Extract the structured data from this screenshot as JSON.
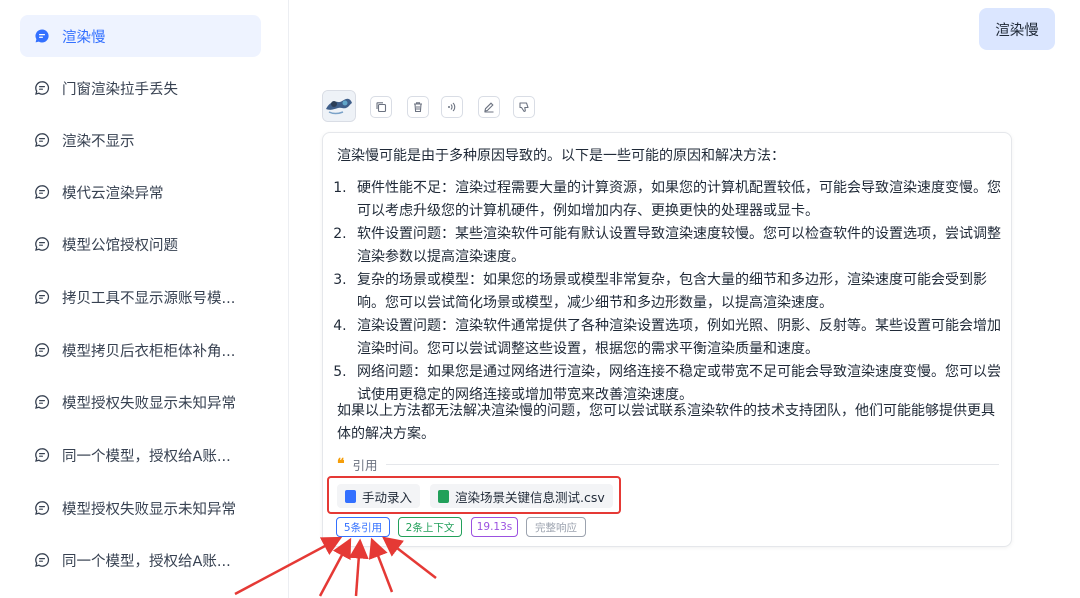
{
  "sidebar": {
    "items": [
      {
        "label": "渲染慢",
        "active": true
      },
      {
        "label": "门窗渲染拉手丢失"
      },
      {
        "label": "渲染不显示"
      },
      {
        "label": "模代云渲染异常"
      },
      {
        "label": "模型公馆授权问题"
      },
      {
        "label": "拷贝工具不显示源账号模..."
      },
      {
        "label": "模型拷贝后衣柜柜体补角..."
      },
      {
        "label": "模型授权失败显示未知异常"
      },
      {
        "label": "同一个模型，授权给A账..."
      },
      {
        "label": "模型授权失败显示未知异常"
      },
      {
        "label": "同一个模型，授权给A账..."
      }
    ]
  },
  "chat": {
    "user_message": "渲染慢",
    "toolbar_icons": [
      "copy-icon",
      "delete-icon",
      "speaker-icon",
      "edit-icon",
      "dislike-icon"
    ],
    "answer": {
      "intro": "渲染慢可能是由于多种原因导致的。以下是一些可能的原因和解决方法：",
      "points": [
        "硬件性能不足：渲染过程需要大量的计算资源，如果您的计算机配置较低，可能会导致渲染速度变慢。您可以考虑升级您的计算机硬件，例如增加内存、更换更快的处理器或显卡。",
        "软件设置问题：某些渲染软件可能有默认设置导致渲染速度较慢。您可以检查软件的设置选项，尝试调整渲染参数以提高渲染速度。",
        "复杂的场景或模型：如果您的场景或模型非常复杂，包含大量的细节和多边形，渲染速度可能会受到影响。您可以尝试简化场景或模型，减少细节和多边形数量，以提高渲染速度。",
        "渲染设置问题：渲染软件通常提供了各种渲染设置选项，例如光照、阴影、反射等。某些设置可能会增加渲染时间。您可以尝试调整这些设置，根据您的需求平衡渲染质量和速度。",
        "网络问题：如果您是通过网络进行渲染，网络连接不稳定或带宽不足可能会导致渲染速度变慢。您可以尝试使用更稳定的网络连接或增加带宽来改善渲染速度。"
      ],
      "outro": "如果以上方法都无法解决渲染慢的问题，您可以尝试联系渲染软件的技术支持团队，他们可能能够提供更具体的解决方案。"
    },
    "quote": {
      "mark": "❝",
      "label": "引用",
      "files": [
        {
          "name": "手动录入",
          "icon": "document-icon",
          "color": "#3370ff"
        },
        {
          "name": "渲染场景关键信息测试.csv",
          "icon": "csv-file-icon",
          "color": "#22a05a"
        }
      ]
    },
    "badges": [
      {
        "label": "5条引用",
        "color": "#3370ff"
      },
      {
        "label": "2条上下文",
        "color": "#22a05a"
      },
      {
        "label": "19.13s",
        "color": "#9b51e0"
      },
      {
        "label": "完整响应",
        "color": "#9ca3af"
      }
    ],
    "annotation_color": "#e53935"
  }
}
